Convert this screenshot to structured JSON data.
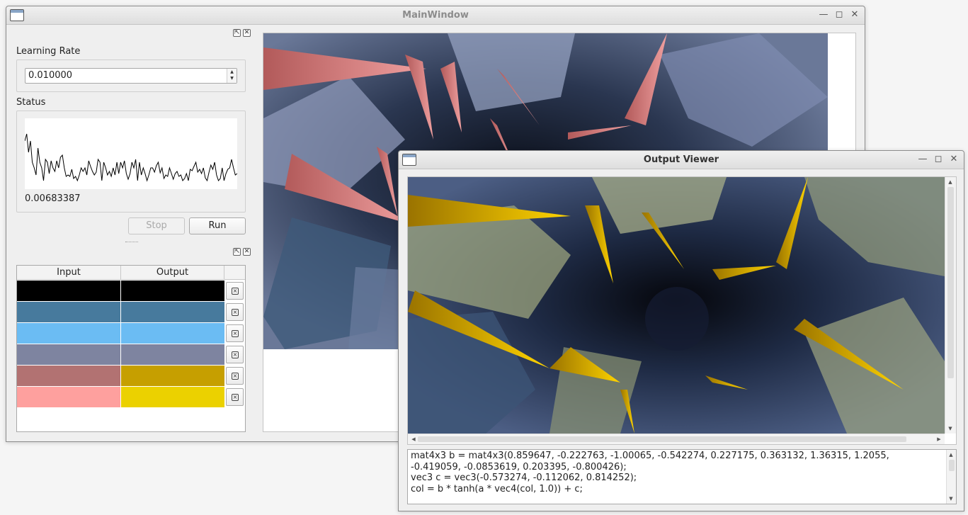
{
  "main_window": {
    "title": "MainWindow",
    "learning_rate_label": "Learning Rate",
    "learning_rate_value": "0.010000",
    "status_label": "Status",
    "loss_value": "0.00683387",
    "stop_label": "Stop",
    "run_label": "Run",
    "table": {
      "headers": [
        "Input",
        "Output"
      ],
      "rows": [
        {
          "input": "#000000",
          "output": "#000000"
        },
        {
          "input": "#477a9d",
          "output": "#477a9d"
        },
        {
          "input": "#6bbcf3",
          "output": "#6bbcf3"
        },
        {
          "input": "#7e84a0",
          "output": "#7e84a0"
        },
        {
          "input": "#b27272",
          "output": "#c69f00"
        },
        {
          "input": "#fea09e",
          "output": "#ebd100"
        }
      ]
    },
    "loss_history": [
      0.68,
      0.78,
      0.52,
      0.68,
      0.38,
      0.3,
      0.2,
      0.58,
      0.38,
      0.3,
      0.12,
      0.42,
      0.38,
      0.22,
      0.4,
      0.3,
      0.25,
      0.4,
      0.3,
      0.45,
      0.48,
      0.3,
      0.18,
      0.2,
      0.18,
      0.28,
      0.15,
      0.18,
      0.12,
      0.2,
      0.3,
      0.25,
      0.3,
      0.2,
      0.4,
      0.32,
      0.25,
      0.2,
      0.24,
      0.42,
      0.38,
      0.12,
      0.38,
      0.3,
      0.2,
      0.25,
      0.18,
      0.3,
      0.2,
      0.38,
      0.22,
      0.38,
      0.3,
      0.4,
      0.22,
      0.14,
      0.22,
      0.38,
      0.3,
      0.42,
      0.12,
      0.38,
      0.2,
      0.3,
      0.22,
      0.12,
      0.2,
      0.3,
      0.3,
      0.24,
      0.33,
      0.38,
      0.23,
      0.3,
      0.15,
      0.2,
      0.18,
      0.3,
      0.22,
      0.14,
      0.22,
      0.25,
      0.18,
      0.2,
      0.12,
      0.15,
      0.22,
      0.12,
      0.28,
      0.26,
      0.32,
      0.38,
      0.24,
      0.28,
      0.22,
      0.3,
      0.16,
      0.12,
      0.24,
      0.34,
      0.28,
      0.38,
      0.2,
      0.12,
      0.15,
      0.3,
      0.12,
      0.22,
      0.28,
      0.3,
      0.42,
      0.3,
      0.2,
      0.22
    ]
  },
  "output_viewer": {
    "title": "Output Viewer",
    "code_lines": [
      "mat4x3 b = mat4x3(0.859647, -0.222763, -1.00065, -0.542274, 0.227175, 0.363132, 1.36315, 1.2055,",
      "-0.419059, -0.0853619, 0.203395, -0.800426);",
      "vec3 c = vec3(-0.573274, -0.112062, 0.814252);",
      "col = b * tanh(a * vec4(col, 1.0)) + c;"
    ]
  },
  "icons": {
    "minimize": "minimize-icon",
    "maximize": "maximize-icon",
    "close": "close-icon",
    "float": "float-icon",
    "delete": "delete-row-icon"
  }
}
